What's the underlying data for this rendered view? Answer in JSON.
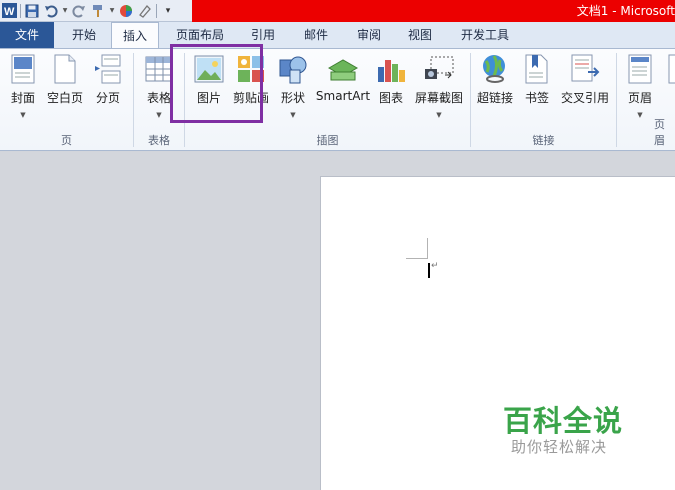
{
  "window": {
    "title": "文档1 - Microsoft"
  },
  "tabs": [
    {
      "label": "文件"
    },
    {
      "label": "开始"
    },
    {
      "label": "插入"
    },
    {
      "label": "页面布局"
    },
    {
      "label": "引用"
    },
    {
      "label": "邮件"
    },
    {
      "label": "审阅"
    },
    {
      "label": "视图"
    },
    {
      "label": "开发工具"
    }
  ],
  "active_tab": "插入",
  "groups": {
    "pages": {
      "label": "页",
      "buttons": [
        "封面",
        "空白页",
        "分页"
      ]
    },
    "tables": {
      "label": "表格",
      "buttons": [
        "表格"
      ]
    },
    "illustrations": {
      "label": "插图",
      "buttons": [
        "图片",
        "剪贴画",
        "形状",
        "SmartArt",
        "图表",
        "屏幕截图"
      ]
    },
    "links": {
      "label": "链接",
      "buttons": [
        "超链接",
        "书签",
        "交叉引用"
      ]
    },
    "header_footer": {
      "label": "页眉",
      "buttons": [
        "页眉"
      ]
    }
  },
  "watermark": {
    "title": "百科全说",
    "subtitle": "助你轻松解决"
  },
  "colors": {
    "title_bar": "#ec0000",
    "file_tab": "#2b5797",
    "highlight": "#7f2fa3",
    "watermark": "#3aa44a"
  }
}
